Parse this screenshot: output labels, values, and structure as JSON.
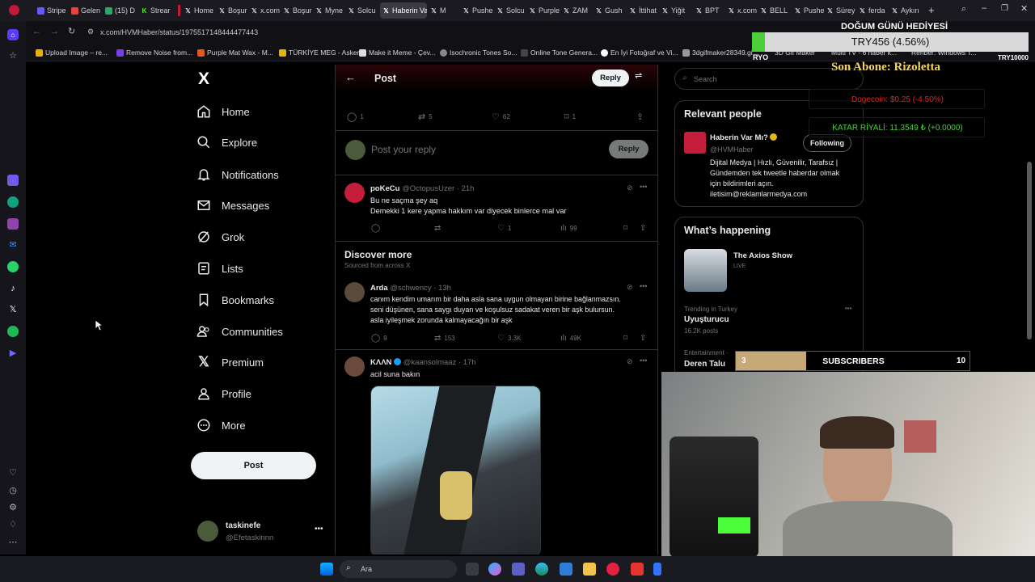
{
  "browser": {
    "tabs": [
      "Stripe",
      "Gelen",
      "(15) D",
      "Strear",
      "Home",
      "Boşur",
      "x.com",
      "Boşur",
      "Myne",
      "Solcu",
      "Haberin Va",
      "M",
      "Pushe",
      "Solcu",
      "Purple",
      "ZAM",
      "Gush",
      "İttihat",
      "Yiğit",
      "BPT",
      "x.com",
      "BELL",
      "Pushe",
      "Sürey",
      "ferda",
      "Aykırı"
    ],
    "url": "x.com/HVMHaber/status/1975517148444477443",
    "bookmarks": [
      "Upload Image – re...",
      "Remove Noise from...",
      "Purple Mat Wax - M...",
      "TÜRKİYE MEG - Asker...",
      "Make it Meme - Çev...",
      "Isochronic Tones So...",
      "Online Tone Genera...",
      "En İyi Fotoğraf ve Vi...",
      "3dgifmaker28349.gi...",
      "3D Gif Maker",
      "Multi TV - 6 haber k...",
      "Rehber: Windows T..."
    ]
  },
  "nav": {
    "logo": "X",
    "items": [
      "Home",
      "Explore",
      "Notifications",
      "Messages",
      "Grok",
      "Lists",
      "Bookmarks",
      "Communities",
      "Premium",
      "Profile",
      "More"
    ],
    "post_button": "Post",
    "account_name": "taskinefe",
    "account_handle": "@Efetaskinnn"
  },
  "header": {
    "title": "Post",
    "reply_button": "Reply"
  },
  "main_post_actions": {
    "replies": "1",
    "reposts": "5",
    "likes": "62",
    "bookmarks": "1"
  },
  "composer": {
    "placeholder": "Post your reply",
    "button": "Reply"
  },
  "reply": {
    "name": "poKeCu",
    "handle": "@OctopusUzer",
    "time": "· 21h",
    "line1": "Bu ne saçma şey aq",
    "line2": "Demekki 1 kere yapma hakkım var diyecek binlerce mal var",
    "likes": "1",
    "views": "99"
  },
  "discover": {
    "title": "Discover more",
    "subtitle": "Sourced from across X"
  },
  "tweet1": {
    "name": "Arda",
    "handle": "@schwency",
    "time": "· 13h",
    "line1": "canım kendim umarım bir daha asla sana uygun olmayan birine bağlanmazsın.",
    "line2": "seni düşünen, sana saygı duyan ve koşulsuz sadakat veren bir aşk bulursun.",
    "line3": "asla iyileşmek zorunda kalmayacağın bir aşk",
    "replies": "9",
    "reposts": "153",
    "likes": "3.3K",
    "views": "49K"
  },
  "tweet2": {
    "name": "ΚΛΛΝ",
    "handle": "@kaansolmaaz",
    "time": "· 17h",
    "text": "acil suna bakın"
  },
  "search": {
    "placeholder": "Search"
  },
  "relevant": {
    "title": "Relevant people",
    "name": "Haberin Var Mı?",
    "handle": "@HVMHaber",
    "follow_button": "Following",
    "bio1": "Dijital Medya | Hızlı, Güvenilir, Tarafsız |",
    "bio2": "Gündemden tek tweetle haberdar olmak",
    "bio3": "için bildirimleri açın.",
    "bio4": "iletisim@reklamlarmedya.com"
  },
  "happening": {
    "title": "What’s happening",
    "show_name": "The Axios Show",
    "show_status": "LIVE",
    "trend_context": "Trending in Turkey",
    "trend_name": "Uyuşturucu",
    "trend_count": "16.2K posts",
    "trend2_context": "Entertainment ·",
    "trend2_name": "Deren Talu"
  },
  "overlay": {
    "birthday": "DOĞUM GÜNÜ HEDİYESİ",
    "try_ticker": "TRY456 (4.56%)",
    "ryo": "RYO",
    "try_goal": "TRY10000",
    "last_sub_label": "Son Abone: Rizoletta",
    "dogecoin": "Dogecoin: $0.25 (-4.50%)",
    "qatar": "KATAR RİYALİ: 11.3549 ₺ (+0.0000)",
    "subs_current": "3",
    "subs_label": "SUBSCRIBERS",
    "subs_goal": "10"
  },
  "taskbar": {
    "search_placeholder": "Ara"
  }
}
